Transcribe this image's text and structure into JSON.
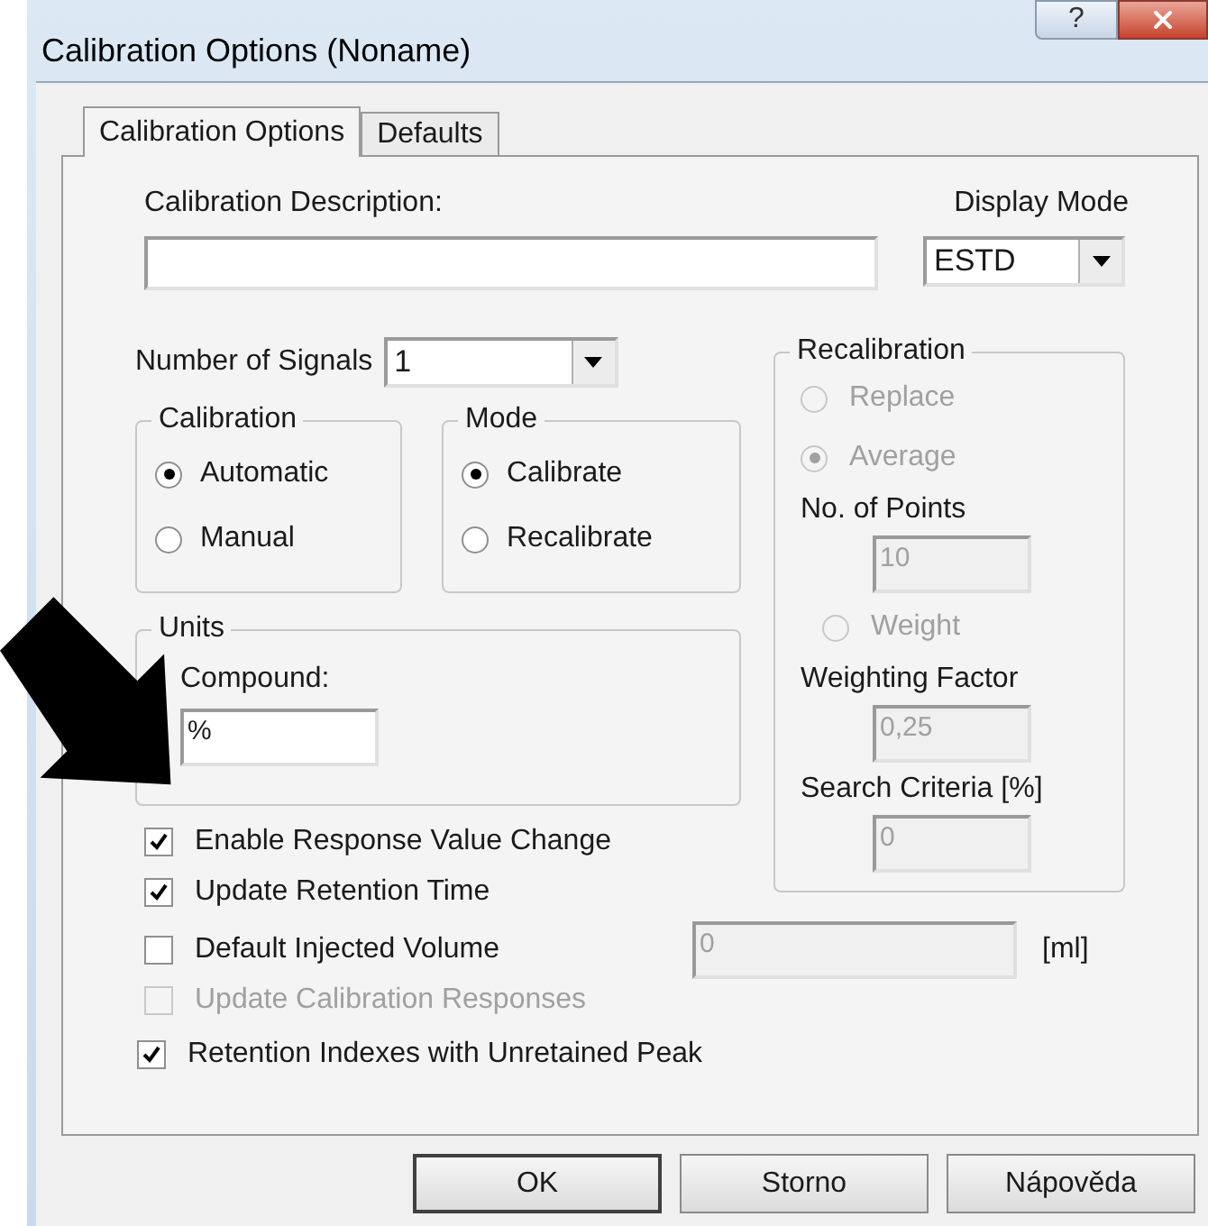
{
  "window": {
    "title": "Calibration Options (Noname)",
    "help_button": "?"
  },
  "tabs": [
    {
      "label": "Calibration Options",
      "selected": true
    },
    {
      "label": "Defaults",
      "selected": false
    }
  ],
  "description": {
    "label": "Calibration Description:"
  },
  "display_mode": {
    "label": "Display Mode",
    "value": "ESTD"
  },
  "signals": {
    "label": "Number of Signals",
    "value": "1"
  },
  "calibration": {
    "title": "Calibration",
    "options": [
      {
        "label": "Automatic",
        "selected": true
      },
      {
        "label": "Manual",
        "selected": false
      }
    ]
  },
  "mode": {
    "title": "Mode",
    "options": [
      {
        "label": "Calibrate",
        "selected": true
      },
      {
        "label": "Recalibrate",
        "selected": false
      }
    ]
  },
  "units": {
    "title": "Units",
    "compound_label": "Compound:",
    "compound_value": "%"
  },
  "recalibration": {
    "title": "Recalibration",
    "items": [
      {
        "kind": "radio",
        "label": "Replace",
        "selected": false,
        "disabled": true
      },
      {
        "kind": "radio",
        "label": "Average",
        "selected": true,
        "disabled": true
      },
      {
        "kind": "field",
        "label": "No. of Points",
        "value": "10",
        "disabled": true
      },
      {
        "kind": "radio",
        "label": "Weight",
        "selected": false,
        "disabled": true
      },
      {
        "kind": "field",
        "label": "Weighting Factor",
        "value": "0,25",
        "disabled": true
      },
      {
        "kind": "field",
        "label": "Search Criteria [%]",
        "value": "0",
        "disabled": true
      }
    ]
  },
  "response_options": [
    {
      "label": "Enable Response Value Change",
      "checked": true,
      "disabled": false
    },
    {
      "label": "Update Retention Time",
      "checked": true,
      "disabled": false
    }
  ],
  "other_options": [
    {
      "kind": "volume",
      "label": "Default Injected Volume",
      "checked": false,
      "disabled": false,
      "value": "0",
      "value_disabled": true,
      "unit": "[ml]"
    },
    {
      "kind": "check",
      "label": "Update Calibration Responses",
      "checked": false,
      "disabled": true
    },
    {
      "kind": "check",
      "label": "Retention Indexes with Unretained Peak",
      "checked": true,
      "disabled": false
    }
  ],
  "buttons": [
    {
      "label": "OK",
      "default": true
    },
    {
      "label": "Storno",
      "default": false
    },
    {
      "label": "Nápověda",
      "default": false
    }
  ]
}
